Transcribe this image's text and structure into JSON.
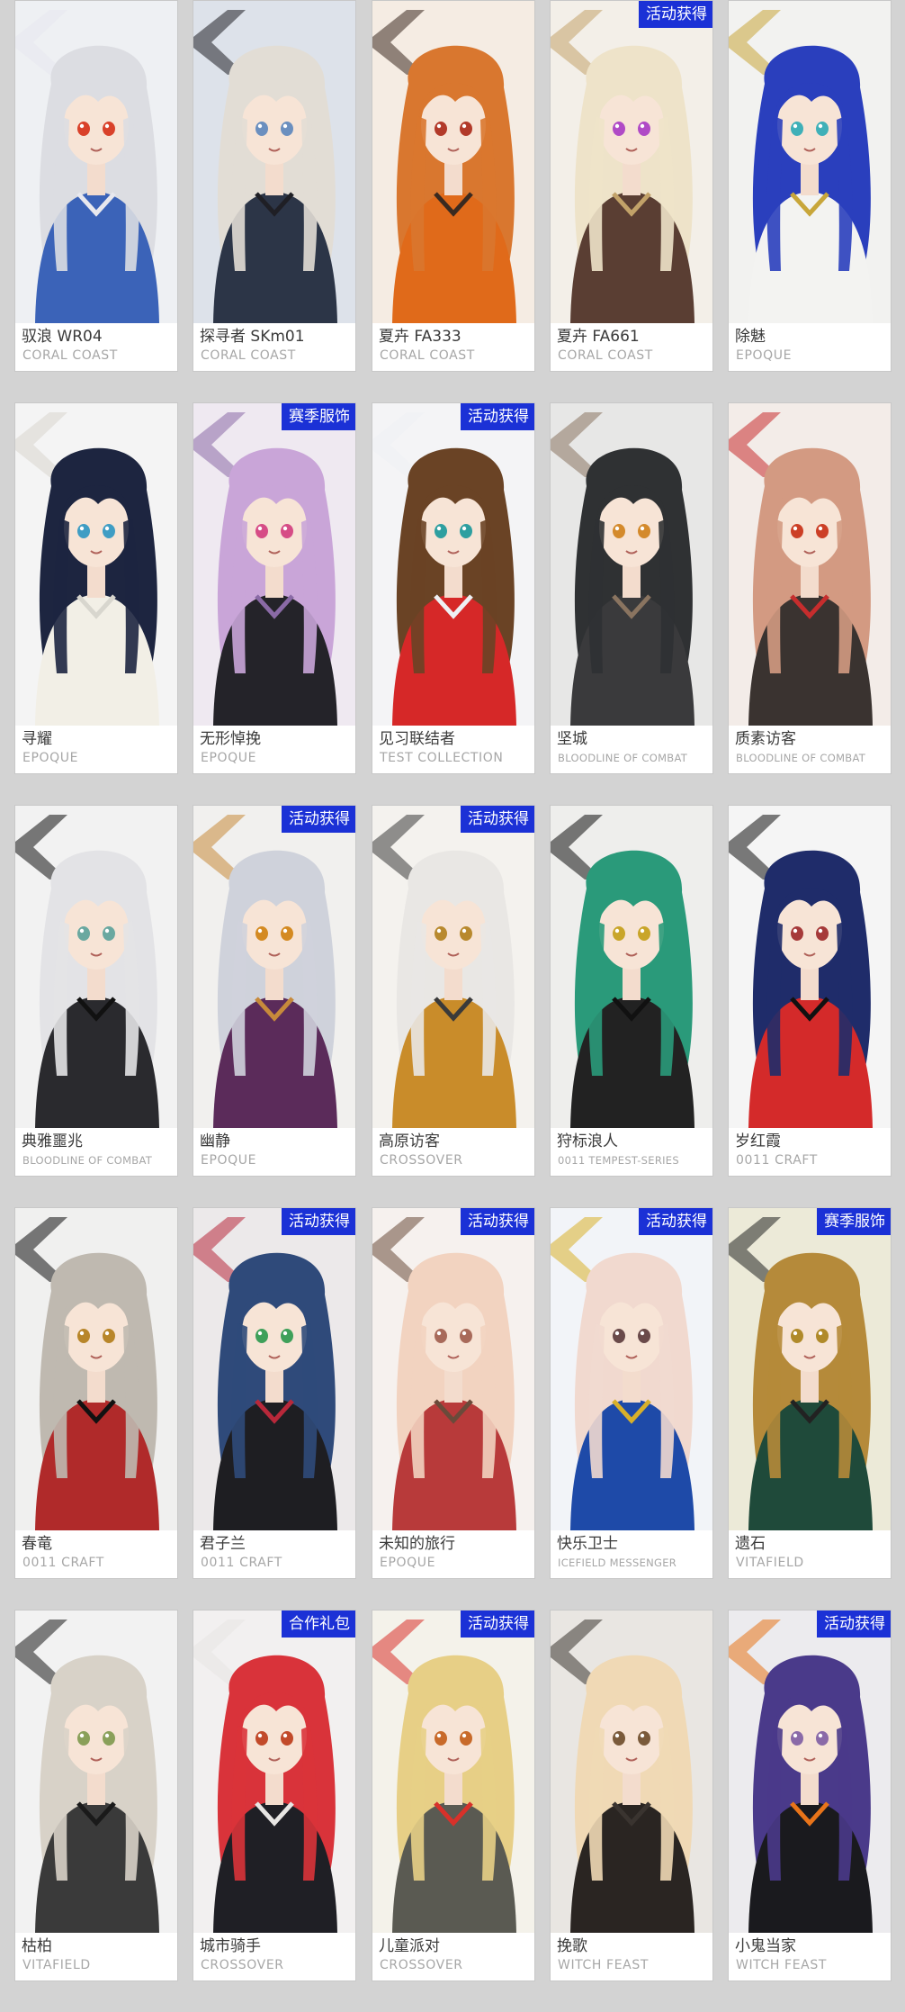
{
  "colors": {
    "page_background": "#d3d3d3",
    "card_background": "#ffffff",
    "name_text": "#3a3a3a",
    "brand_text": "#a6a6a6",
    "badge_background": "#1b31d6",
    "badge_text": "#ffffff"
  },
  "skins": [
    {
      "name": "驭浪 WR04",
      "brand": "CORAL COAST",
      "badge": "",
      "hair": "#dcdde2",
      "outfit": "#3b63b8",
      "eyes": "#d9412a",
      "bg": "#eef0f3",
      "accent": "#e8e8ee"
    },
    {
      "name": "探寻者 SKm01",
      "brand": "CORAL COAST",
      "badge": "",
      "hair": "#e2ddd5",
      "outfit": "#2c3547",
      "eyes": "#6b8fbf",
      "bg": "#dde2ea",
      "accent": "#1f1f25"
    },
    {
      "name": "夏卉 FA333",
      "brand": "CORAL COAST",
      "badge": "",
      "hair": "#d9772f",
      "outfit": "#e06a1a",
      "eyes": "#b23a2a",
      "bg": "#f5ece3",
      "accent": "#3a2a20"
    },
    {
      "name": "夏卉 FA661",
      "brand": "CORAL COAST",
      "badge": "活动获得",
      "hair": "#eee3c9",
      "outfit": "#5a3e33",
      "eyes": "#b04ac6",
      "bg": "#f3efe8",
      "accent": "#c2a269"
    },
    {
      "name": "除魅",
      "brand": "EPOQUE",
      "badge": "",
      "hair": "#2a3fbd",
      "outfit": "#f3f3f1",
      "eyes": "#3fb0b8",
      "bg": "#f2f2f0",
      "accent": "#c8a63a"
    },
    {
      "name": "寻耀",
      "brand": "EPOQUE",
      "badge": "",
      "hair": "#1d2540",
      "outfit": "#f2efe6",
      "eyes": "#3f9dc4",
      "bg": "#f4f4f4",
      "accent": "#d8d6ce"
    },
    {
      "name": "无形悼挽",
      "brand": "EPOQUE",
      "badge": "赛季服饰",
      "hair": "#c9a5d8",
      "outfit": "#242329",
      "eyes": "#d64c86",
      "bg": "#efe9f1",
      "accent": "#8a6aa6"
    },
    {
      "name": "见习联结者",
      "brand": "TEST COLLECTION",
      "badge": "活动获得",
      "hair": "#6a4325",
      "outfit": "#d62828",
      "eyes": "#2e9fa0",
      "bg": "#f4f4f6",
      "accent": "#eef0f4"
    },
    {
      "name": "坚城",
      "brand": "BLOODLINE OF COMBAT",
      "badge": "",
      "hair": "#2f3133",
      "outfit": "#3a3a3c",
      "eyes": "#d48a2c",
      "bg": "#e7e7e6",
      "accent": "#8a7460"
    },
    {
      "name": "质素访客",
      "brand": "BLOODLINE OF COMBAT",
      "badge": "",
      "hair": "#d39a82",
      "outfit": "#3a3330",
      "eyes": "#cc3f26",
      "bg": "#f3ece8",
      "accent": "#c62d2d"
    },
    {
      "name": "典雅噩兆",
      "brand": "BLOODLINE OF COMBAT",
      "badge": "",
      "hair": "#e3e3e6",
      "outfit": "#2a2a2e",
      "eyes": "#6aa8a0",
      "bg": "#f2f2f2",
      "accent": "#111111"
    },
    {
      "name": "幽静",
      "brand": "EPOQUE",
      "badge": "活动获得",
      "hair": "#cfd2db",
      "outfit": "#5b2b5a",
      "eyes": "#d48a22",
      "bg": "#f1f0ee",
      "accent": "#c78a3b"
    },
    {
      "name": "高原访客",
      "brand": "CROSSOVER",
      "badge": "活动获得",
      "hair": "#e9e7e4",
      "outfit": "#c98c2a",
      "eyes": "#b8892e",
      "bg": "#f4f2ee",
      "accent": "#3a3a3a"
    },
    {
      "name": "狩标浪人",
      "brand": "0011 TEMPEST-SERIES",
      "badge": "",
      "hair": "#2a9a7a",
      "outfit": "#222222",
      "eyes": "#c9a52a",
      "bg": "#eeeeec",
      "accent": "#111111"
    },
    {
      "name": "岁红霞",
      "brand": "0011 CRAFT",
      "badge": "",
      "hair": "#1f2c6a",
      "outfit": "#d42a2a",
      "eyes": "#a63a3a",
      "bg": "#f5f5f5",
      "accent": "#111111"
    },
    {
      "name": "春竜",
      "brand": "0011 CRAFT",
      "badge": "",
      "hair": "#bfb9b0",
      "outfit": "#b02a2a",
      "eyes": "#b8862a",
      "bg": "#f0f0ef",
      "accent": "#111111"
    },
    {
      "name": "君子兰",
      "brand": "0011 CRAFT",
      "badge": "活动获得",
      "hair": "#2f4a7a",
      "outfit": "#1e1e22",
      "eyes": "#3fa05a",
      "bg": "#ece9ea",
      "accent": "#b8283a"
    },
    {
      "name": "未知的旅行",
      "brand": "EPOQUE",
      "badge": "活动获得",
      "hair": "#f2d3c0",
      "outfit": "#b83a3a",
      "eyes": "#a86a5a",
      "bg": "#f6f1ee",
      "accent": "#6a4a3a"
    },
    {
      "name": "快乐卫士",
      "brand": "ICEFIELD MESSENGER",
      "badge": "活动获得",
      "hair": "#f1d9cf",
      "outfit": "#1e4aa8",
      "eyes": "#6a4a4a",
      "bg": "#f2f4f8",
      "accent": "#d8b02a"
    },
    {
      "name": "遗石",
      "brand": "VITAFIELD",
      "badge": "赛季服饰",
      "hair": "#b58a3a",
      "outfit": "#1f4a3a",
      "eyes": "#b08a2a",
      "bg": "#ecead8",
      "accent": "#222222"
    },
    {
      "name": "枯柏",
      "brand": "VITAFIELD",
      "badge": "",
      "hair": "#d8d2c8",
      "outfit": "#3a3a3a",
      "eyes": "#8aa05a",
      "bg": "#f2f2f2",
      "accent": "#1a1a1a"
    },
    {
      "name": "城市骑手",
      "brand": "CROSSOVER",
      "badge": "合作礼包",
      "hair": "#d9333a",
      "outfit": "#1f1f25",
      "eyes": "#c24a2a",
      "bg": "#f2f0f0",
      "accent": "#e8e6e4"
    },
    {
      "name": "儿童派对",
      "brand": "CROSSOVER",
      "badge": "活动获得",
      "hair": "#e7cf86",
      "outfit": "#5a5a52",
      "eyes": "#c86a2a",
      "bg": "#f4f2ea",
      "accent": "#d8312a"
    },
    {
      "name": "挽歌",
      "brand": "WITCH FEAST",
      "badge": "",
      "hair": "#f0d9b5",
      "outfit": "#2a2522",
      "eyes": "#7a5a3a",
      "bg": "#e9e6e2",
      "accent": "#3a3430"
    },
    {
      "name": "小鬼当家",
      "brand": "WITCH FEAST",
      "badge": "活动获得",
      "hair": "#4a3a8a",
      "outfit": "#1a1a1e",
      "eyes": "#8a6aa8",
      "bg": "#ecebee",
      "accent": "#e8741a"
    }
  ]
}
